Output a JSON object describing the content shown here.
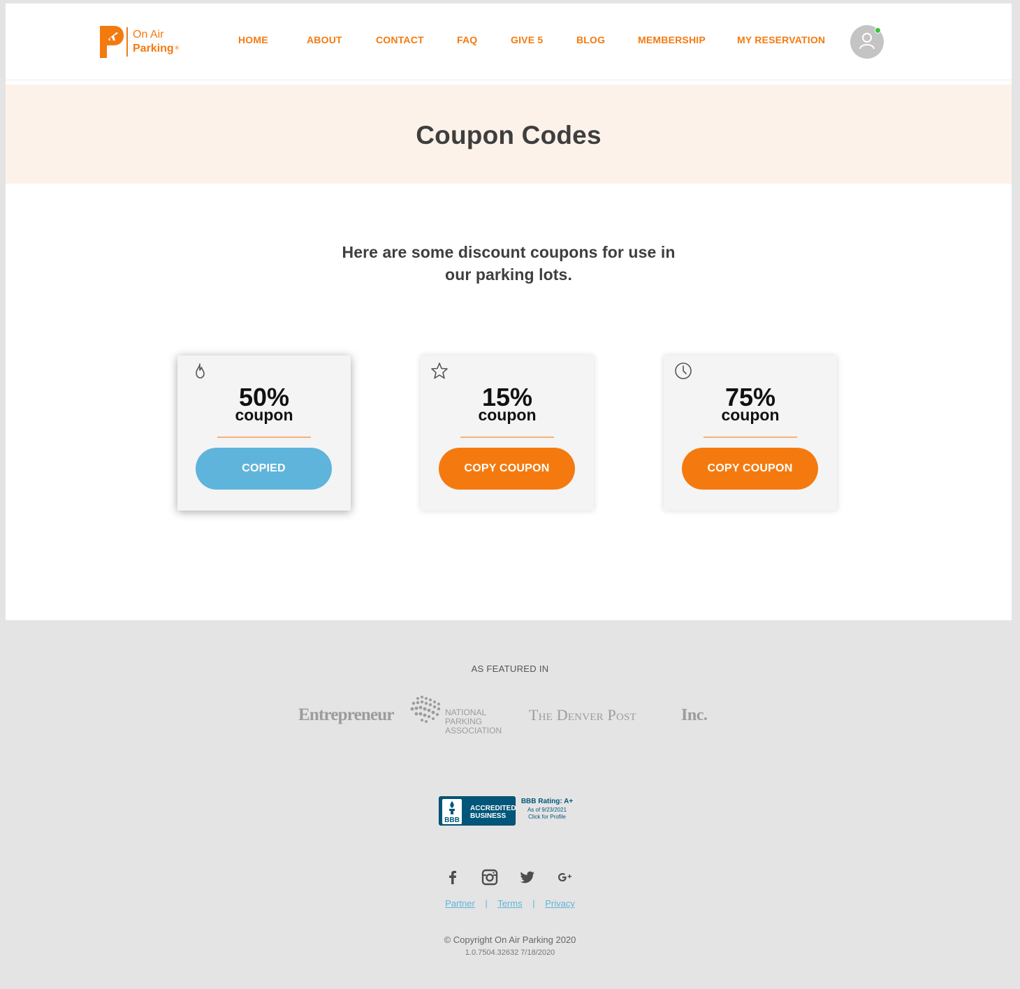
{
  "header": {
    "logo": {
      "line1": "On Air",
      "line2": "Parking",
      "reg": "®"
    },
    "nav": [
      "HOME",
      "ABOUT",
      "CONTACT",
      "FAQ",
      "GIVE 5",
      "BLOG",
      "MEMBERSHIP",
      "MY RESERVATION"
    ],
    "avatar_icon": "user-icon",
    "status_color": "#3bc13b"
  },
  "banner": {
    "title": "Coupon Codes"
  },
  "intro": {
    "line1": "Here are some discount coupons for use in",
    "line2": "our parking lots."
  },
  "coupons": [
    {
      "icon": "flame-icon",
      "percent": "50%",
      "word": "coupon",
      "button": "COPIED",
      "state": "copied"
    },
    {
      "icon": "star-icon",
      "percent": "15%",
      "word": "coupon",
      "button": "COPY COUPON",
      "state": "default"
    },
    {
      "icon": "clock-icon",
      "percent": "75%",
      "word": "coupon",
      "button": "COPY COUPON",
      "state": "default"
    }
  ],
  "footer": {
    "featured_title": "AS FEATURED IN",
    "press": {
      "entrepreneur": "Entrepreneur",
      "npa": {
        "line1": "NATIONAL",
        "line2": "PARKING",
        "line3": "ASSOCIATION",
        "tm": "™"
      },
      "denver": "The Denver Post",
      "inc": "Inc."
    },
    "bbb": {
      "mini": "BBB",
      "accredited_1": "ACCREDITED",
      "accredited_2": "BUSINESS",
      "rating": "BBB Rating: A+",
      "as_of": "As of 9/23/2021",
      "click": "Click for Profile"
    },
    "social": [
      "facebook-icon",
      "instagram-icon",
      "twitter-icon",
      "google-plus-icon"
    ],
    "links": {
      "partner": "Partner",
      "terms": "Terms",
      "privacy": "Privacy",
      "sep": "|"
    },
    "copyright": "© Copyright On Air Parking 2020",
    "version": "1.0.7504.32632 7/18/2020"
  },
  "colors": {
    "accent": "#f47a0f",
    "copied": "#5fb4db",
    "banner_bg": "#fcf2ea",
    "footer_bg": "#e4e4e4"
  }
}
